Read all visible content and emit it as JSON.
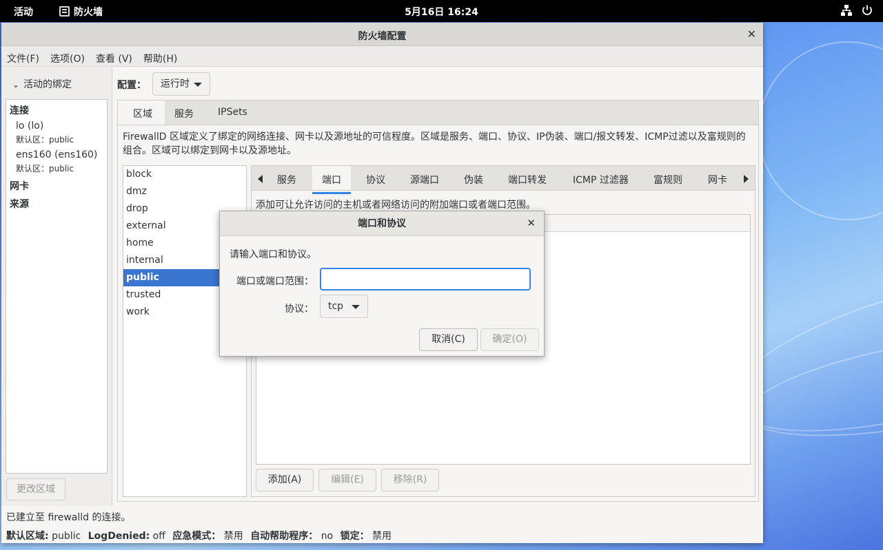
{
  "topbar": {
    "activities": "活动",
    "app_name": "防火墙",
    "clock": "5月16日  16:24",
    "network_icon": "network-icon",
    "power_icon": "power-icon"
  },
  "window": {
    "title": "防火墙配置",
    "menus": [
      "文件(F)",
      "选项(O)",
      "查看 (V)",
      "帮助(H)"
    ]
  },
  "left": {
    "bindings_header": "活动的绑定",
    "connections_label": "连接",
    "connections": [
      {
        "name": "lo (lo)",
        "zone": "默认区：public"
      },
      {
        "name": "ens160 (ens160)",
        "zone": "默认区：public"
      }
    ],
    "nic_label": "网卡",
    "source_label": "来源",
    "change_zone_button": "更改区域"
  },
  "config": {
    "label": "配置：",
    "value": "运行时"
  },
  "outer_tabs": [
    "区域",
    "服务",
    "IPSets"
  ],
  "zone_description": "FirewallD 区域定义了绑定的网络连接、网卡以及源地址的可信程度。区域是服务、端口、协议、IP伪装、端口/报文转发、ICMP过滤以及富规则的组合。区域可以绑定到网卡以及源地址。",
  "zones": [
    "block",
    "dmz",
    "drop",
    "external",
    "home",
    "internal",
    "public",
    "trusted",
    "work"
  ],
  "selected_zone": "public",
  "inner_tabs": [
    "服务",
    "端口",
    "协议",
    "源端口",
    "伪装",
    "端口转发",
    "ICMP 过滤器",
    "富规则",
    "网卡"
  ],
  "port_description": "添加可让允许访问的主机或者网络访问的附加端口或者端口范围。",
  "port_buttons": {
    "add": "添加(A)",
    "edit": "编辑(E)",
    "remove": "移除(R)"
  },
  "status": {
    "connection": "已建立至 firewalld 的连接。",
    "default_zone_label": "默认区域:",
    "default_zone": "public",
    "log_denied_label": "LogDenied:",
    "log_denied": "off",
    "panic_label": "应急模式：",
    "panic": "禁用",
    "helpers_label": "自动帮助程序：",
    "helpers": "no",
    "lockdown_label": "锁定：",
    "lockdown": "禁用"
  },
  "dialog": {
    "title": "端口和协议",
    "prompt": "请输入端口和协议。",
    "port_label": "端口或端口范围：",
    "port_value": "",
    "protocol_label": "协议：",
    "protocol_value": "tcp",
    "cancel_button": "取消(C)",
    "ok_button": "确定(O)"
  },
  "colors": {
    "accent": "#3584e4",
    "selection": "#3a75d0"
  }
}
